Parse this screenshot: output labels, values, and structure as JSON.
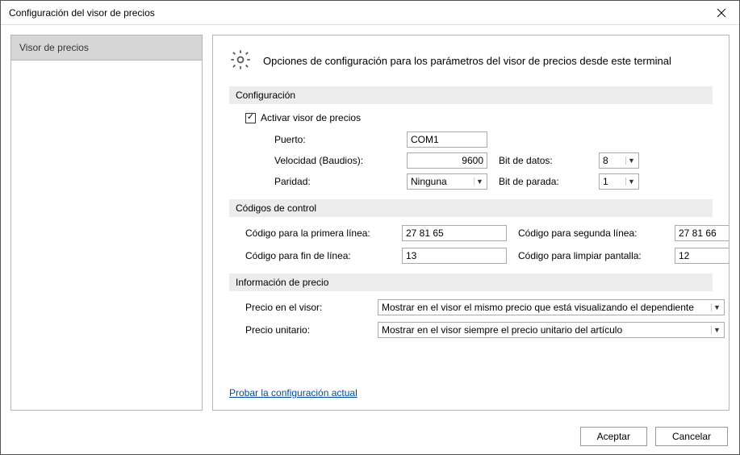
{
  "window": {
    "title": "Configuración del visor de precios"
  },
  "sidebar": {
    "items": [
      {
        "label": "Visor de precios"
      }
    ]
  },
  "header": {
    "text": "Opciones de configuración para los parámetros del visor de precios desde este terminal"
  },
  "sections": {
    "config": {
      "title": "Configuración",
      "activate_label": "Activar visor de precios",
      "port_label": "Puerto:",
      "port_value": "COM1",
      "baud_label": "Velocidad (Baudios):",
      "baud_value": "9600",
      "databits_label": "Bit de datos:",
      "databits_value": "8",
      "parity_label": "Paridad:",
      "parity_value": "Ninguna",
      "stopbit_label": "Bit de parada:",
      "stopbit_value": "1"
    },
    "codes": {
      "title": "Códigos de control",
      "line1_label": "Código para la primera línea:",
      "line1_value": "27 81 65",
      "line2_label": "Código para segunda línea:",
      "line2_value": "27 81 66",
      "eol_label": "Código para fin de línea:",
      "eol_value": "13",
      "clear_label": "Código para limpiar pantalla:",
      "clear_value": "12"
    },
    "price": {
      "title": "Información de precio",
      "visor_label": "Precio en el visor:",
      "visor_value": "Mostrar en el visor el mismo precio que está visualizando el dependiente",
      "unit_label": "Precio unitario:",
      "unit_value": "Mostrar en el visor siempre el precio unitario del artículo"
    }
  },
  "link": {
    "test_config": "Probar la configuración actual"
  },
  "buttons": {
    "accept": "Aceptar",
    "cancel": "Cancelar"
  }
}
